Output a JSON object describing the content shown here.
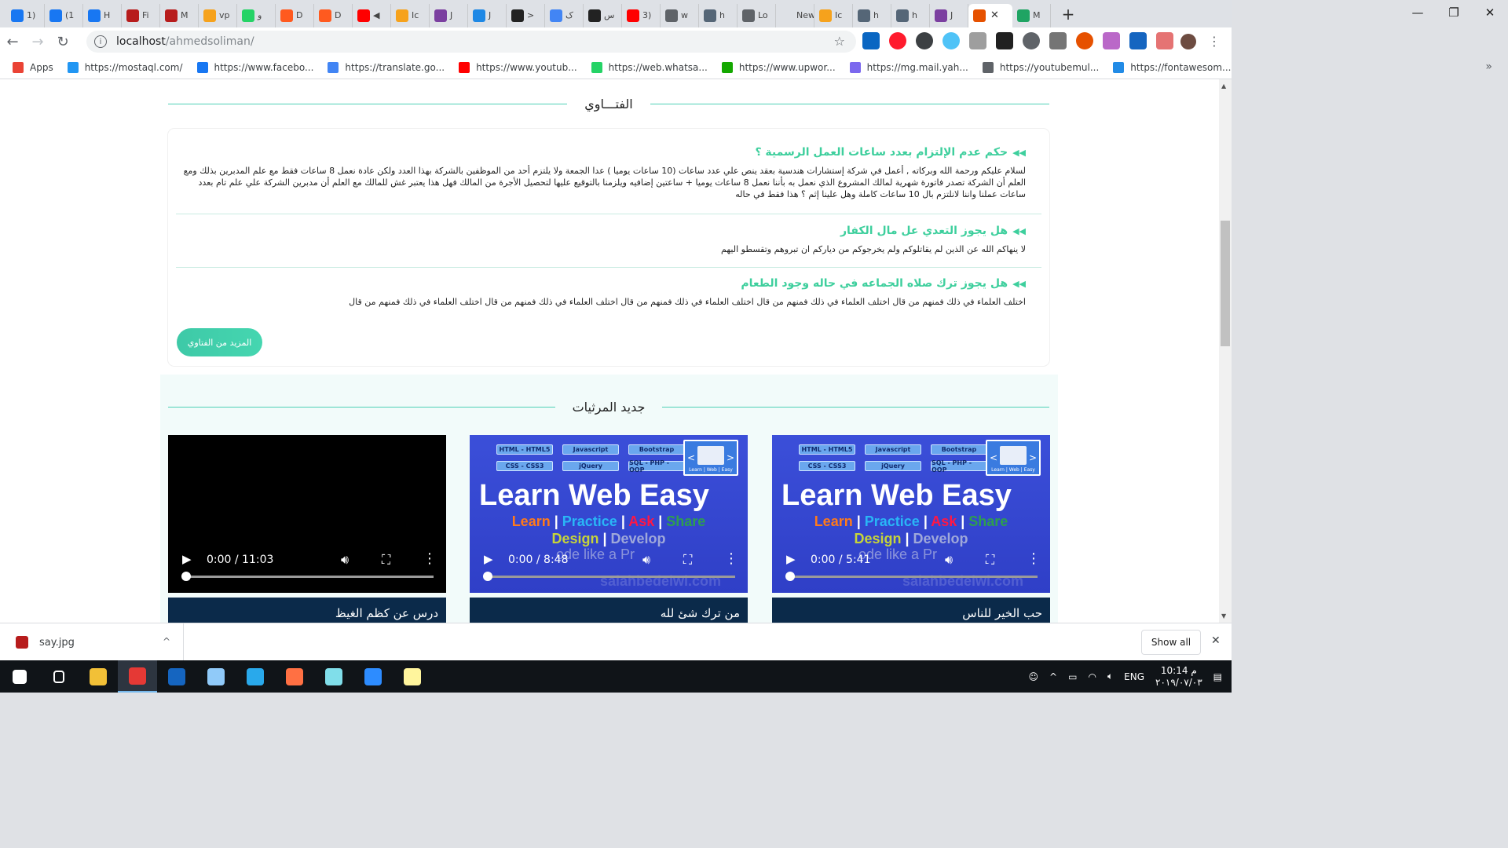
{
  "browser": {
    "tabs": [
      {
        "label": "1)",
        "color": "#1877f2"
      },
      {
        "label": "(1",
        "color": "#1877f2"
      },
      {
        "label": "H",
        "color": "#1877f2"
      },
      {
        "label": "Fi",
        "color": "#b71c1c"
      },
      {
        "label": "M",
        "color": "#b71c1c"
      },
      {
        "label": "vp",
        "color": "#f6a21c"
      },
      {
        "label": "و",
        "color": "#25d366"
      },
      {
        "label": "D",
        "color": "#ff5a1f"
      },
      {
        "label": "D",
        "color": "#ff5a1f"
      },
      {
        "label": "◀",
        "color": "#ff0000"
      },
      {
        "label": "Ic",
        "color": "#f6a21c"
      },
      {
        "label": "J",
        "color": "#7b3fa0"
      },
      {
        "label": "J",
        "color": "#1e88e5"
      },
      {
        "label": ">",
        "color": "#222222"
      },
      {
        "label": "ک",
        "color": "#4285f4"
      },
      {
        "label": "س",
        "color": "#222222"
      },
      {
        "label": "3)",
        "color": "#ff0000"
      },
      {
        "label": "w",
        "color": "#5f6368"
      },
      {
        "label": "h",
        "color": "#556677"
      },
      {
        "label": "Lo",
        "color": "#5f6368"
      },
      {
        "label": "New T",
        "color": "#dee1e6"
      },
      {
        "label": "Ic",
        "color": "#f6a21c"
      },
      {
        "label": "h",
        "color": "#556677"
      },
      {
        "label": "h",
        "color": "#556677"
      },
      {
        "label": "J",
        "color": "#7b3fa0"
      }
    ],
    "active_tab": {
      "color": "#e65100"
    },
    "active_tab_close": "✕",
    "new_tab": "+",
    "window_controls": {
      "minimize": "—",
      "maximize": "❐",
      "close": "✕"
    },
    "url": {
      "host": "localhost",
      "path": "/ahmedsoliman/"
    },
    "star": "☆",
    "bookmarks": [
      {
        "label": "Apps",
        "icon": "apps-icon",
        "color": "#ea4335"
      },
      {
        "label": "https://mostaql.com/",
        "icon": "mostaql-icon",
        "color": "#2196f3"
      },
      {
        "label": "https://www.facebo...",
        "icon": "facebook-icon",
        "color": "#1877f2"
      },
      {
        "label": "https://translate.go...",
        "icon": "translate-icon",
        "color": "#4285f4"
      },
      {
        "label": "https://www.youtub...",
        "icon": "youtube-icon",
        "color": "#ff0000"
      },
      {
        "label": "https://web.whatsa...",
        "icon": "whatsapp-icon",
        "color": "#25d366"
      },
      {
        "label": "https://www.upwor...",
        "icon": "upwork-icon",
        "color": "#14a800"
      },
      {
        "label": "https://mg.mail.yah...",
        "icon": "yahoo-mail-icon",
        "color": "#7b68ee"
      },
      {
        "label": "https://youtubemul...",
        "icon": "globe-icon",
        "color": "#5f6368"
      },
      {
        "label": "https://fontawesom...",
        "icon": "fontawesome-icon",
        "color": "#228be6"
      }
    ],
    "bookmarks_more": "»"
  },
  "page": {
    "fatawa_title": "الفتـــاوي",
    "questions": [
      {
        "title": "حكم عدم الإلتزام بعدد ساعات العمل الرسمية ؟",
        "answer": "لسلام عليكم ورحمة الله وبركاته , أعمل في شركة إستشارات هندسية بعقد ينص علي عدد ساعات (10 ساعات يوميا ) عدا الجمعة ولا يلتزم أحد من الموظفين بالشركة بهذا العدد ولكن عادة نعمل 8 ساعات فقط مع علم المدبرين بذلك ومع العلم أن الشركة تصدر فاتورة شهرية لمالك المشروع الذي نعمل به بأننا نعمل 8 ساعات يوميا + ساعتين إضافيه ويلزمنا بالتوقيع عليها لتحصيل الأجرة من المالك فهل هذا يعتبر غش للمالك مع العلم أن مدبرين الشركة علي علم تام بعدد ساعات عملنا واننا لانلتزم بال 10 ساعات كاملة وهل علينا إثم ؟ هذا فقط في حاله"
      },
      {
        "title": "هل يجوز التعدي عل مال الكفار",
        "answer": "لا ينهاكم الله عن الذين لم يقاتلوكم ولم يخرجوكم من دياركم ان تبروهم وتقسطو اليهم"
      },
      {
        "title": "هل يجوز ترك صلاه الجماعه في حاله وجود الطعام",
        "answer": "اختلف العلماء في ذلك فمنهم من قال اختلف العلماء في ذلك فمنهم من قال اختلف العلماء في ذلك فمنهم من قال اختلف العلماء في ذلك فمنهم من قال اختلف العلماء في ذلك فمنهم من قال"
      }
    ],
    "more_fatawa_button": "المزيد من الفتاوي",
    "rathaa_title": "جديد المرثيات",
    "videos": [
      {
        "time": "0:00 / 11:03",
        "title": "درس عن كظم الغيظ",
        "poster": false
      },
      {
        "time": "0:00 / 8:48",
        "title": "من ترك شئ لله",
        "poster": true
      },
      {
        "time": "0:00 / 5:41",
        "title": "حب الخير للناس",
        "poster": true
      }
    ],
    "poster": {
      "tags": [
        "HTML - HTML5",
        "Javascript",
        "Bootstrap",
        "CSS - CSS3",
        "jQuery",
        "SQL - PHP - OOP"
      ],
      "headline": "Learn Web Easy",
      "line1": [
        {
          "text": "Learn",
          "color": "#ff7a1a"
        },
        {
          "text": " | ",
          "color": "#ffffff"
        },
        {
          "text": "Practice",
          "color": "#29b6f6"
        },
        {
          "text": " | ",
          "color": "#ffffff"
        },
        {
          "text": "Ask",
          "color": "#ff1744"
        },
        {
          "text": " | ",
          "color": "#ffffff"
        },
        {
          "text": "Share",
          "color": "#2e9e4e"
        }
      ],
      "line2": [
        {
          "text": "Design",
          "color": "#c6d43a"
        },
        {
          "text": " | ",
          "color": "#ffffff"
        },
        {
          "text": "Develop",
          "color": "#9fa8da"
        }
      ],
      "line3": "ode like a Pr",
      "book_caption": "Learn | Web | Easy",
      "watermark": "salahbedeiwi.com"
    }
  },
  "download_bar": {
    "filename": "say.jpg",
    "show_all": "Show all",
    "close": "✕"
  },
  "taskbar": {
    "apps": [
      {
        "name": "start-icon",
        "color": "#ffffff"
      },
      {
        "name": "task-view-icon",
        "color": "#ffffff"
      },
      {
        "name": "file-explorer-icon",
        "color": "#f2c037"
      },
      {
        "name": "chrome-icon",
        "color": "#e53935"
      },
      {
        "name": "app-icon-blue",
        "color": "#1565c0"
      },
      {
        "name": "cube-app-icon",
        "color": "#90caf9"
      },
      {
        "name": "telegram-icon",
        "color": "#29a9eb"
      },
      {
        "name": "pen-app-icon",
        "color": "#ff7043"
      },
      {
        "name": "book-app-icon",
        "color": "#80deea"
      },
      {
        "name": "zoom-icon",
        "color": "#2d8cff"
      },
      {
        "name": "paint-icon",
        "color": "#fff59d"
      }
    ],
    "language": "ENG",
    "time": "10:14 م",
    "date": "٢٠١٩/٠٧/٠٣"
  }
}
